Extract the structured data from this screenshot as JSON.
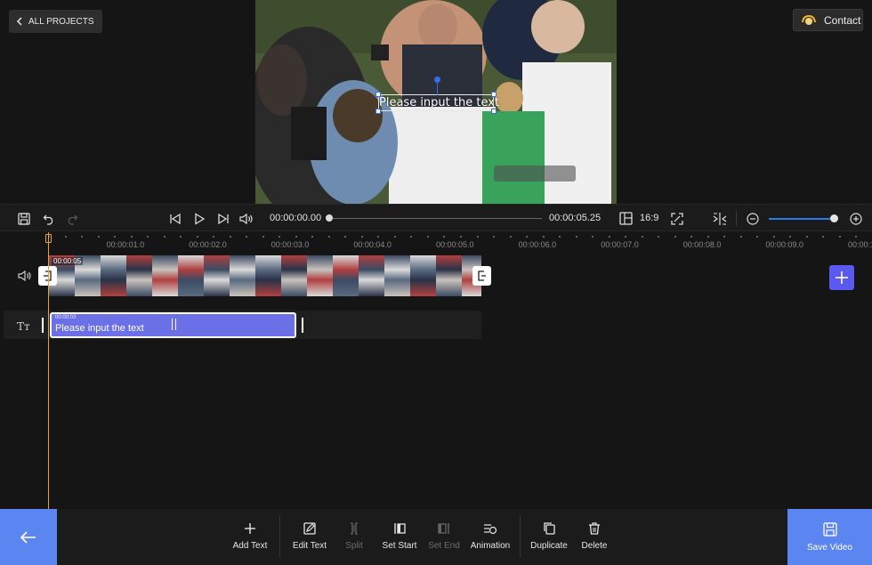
{
  "header": {
    "back_label": "ALL PROJECTS",
    "contact_label": "Contact"
  },
  "preview": {
    "overlay_text": "Please input the text"
  },
  "playback": {
    "current_time": "00:00:00.00",
    "total_time": "00:00:05.25",
    "aspect_ratio": "16:9",
    "progress": 0
  },
  "timeline": {
    "ruler_labels": [
      "00:00:01.0",
      "00:00:02.0",
      "00:00:03.0",
      "00:00:04.0",
      "00:00:05.0",
      "00:00:06.0",
      "00:00:07.0",
      "00:00:08.0",
      "00:00:09.0",
      "00:00:1"
    ],
    "video_clip_timestamp": "00:00:05",
    "text_clip": {
      "timestamp": "00:00:03",
      "label": "Please input the text"
    }
  },
  "toolbar": {
    "tools": [
      {
        "label": "Add Text",
        "icon": "plus-icon",
        "enabled": true
      },
      {
        "label": "Edit Text",
        "icon": "edit-icon",
        "enabled": true
      },
      {
        "label": "Split",
        "icon": "split-icon",
        "enabled": false
      },
      {
        "label": "Set Start",
        "icon": "set-start-icon",
        "enabled": true
      },
      {
        "label": "Set End",
        "icon": "set-end-icon",
        "enabled": false
      },
      {
        "label": "Animation",
        "icon": "animation-icon",
        "enabled": true
      },
      {
        "label": "Duplicate",
        "icon": "duplicate-icon",
        "enabled": true
      },
      {
        "label": "Delete",
        "icon": "trash-icon",
        "enabled": true
      }
    ],
    "save_label": "Save Video"
  },
  "colors": {
    "accent": "#5b86f2",
    "text_clip": "#6b70e6",
    "playhead": "#e2a53a",
    "add_clip": "#5a5af0"
  }
}
